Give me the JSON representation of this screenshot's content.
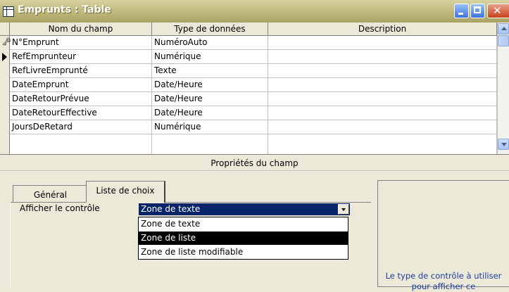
{
  "window": {
    "title": "Emprunts : Table"
  },
  "grid": {
    "columns": [
      "Nom du champ",
      "Type de données",
      "Description"
    ],
    "rows": [
      {
        "name": "N°Emprunt",
        "type": "NuméroAuto",
        "description": "",
        "selector": "key"
      },
      {
        "name": "RefEmprunteur",
        "type": "Numérique",
        "description": "",
        "selector": "current"
      },
      {
        "name": "RefLivreEmprunté",
        "type": "Texte",
        "description": "",
        "selector": ""
      },
      {
        "name": "DateEmprunt",
        "type": "Date/Heure",
        "description": "",
        "selector": ""
      },
      {
        "name": "DateRetourPrévue",
        "type": "Date/Heure",
        "description": "",
        "selector": ""
      },
      {
        "name": "DateRetourEffective",
        "type": "Date/Heure",
        "description": "",
        "selector": ""
      },
      {
        "name": "JoursDeRetard",
        "type": "Numérique",
        "description": "",
        "selector": ""
      }
    ]
  },
  "properties": {
    "title": "Propriétés du champ",
    "tabs": [
      "Général",
      "Liste de choix"
    ],
    "active_tab": "Liste de choix",
    "row_label": "Afficher le contrôle",
    "combo_value": "Zone de texte",
    "dropdown_options": [
      "Zone de texte",
      "Zone de liste",
      "Zone de liste modifiable"
    ],
    "highlighted_option": "Zone de liste",
    "help_text": "Le type de contrôle à utiliser pour afficher ce"
  },
  "colors": {
    "title_bar": "#b8b070",
    "selection": "#0a246a",
    "help_text": "#1c3d9c"
  }
}
